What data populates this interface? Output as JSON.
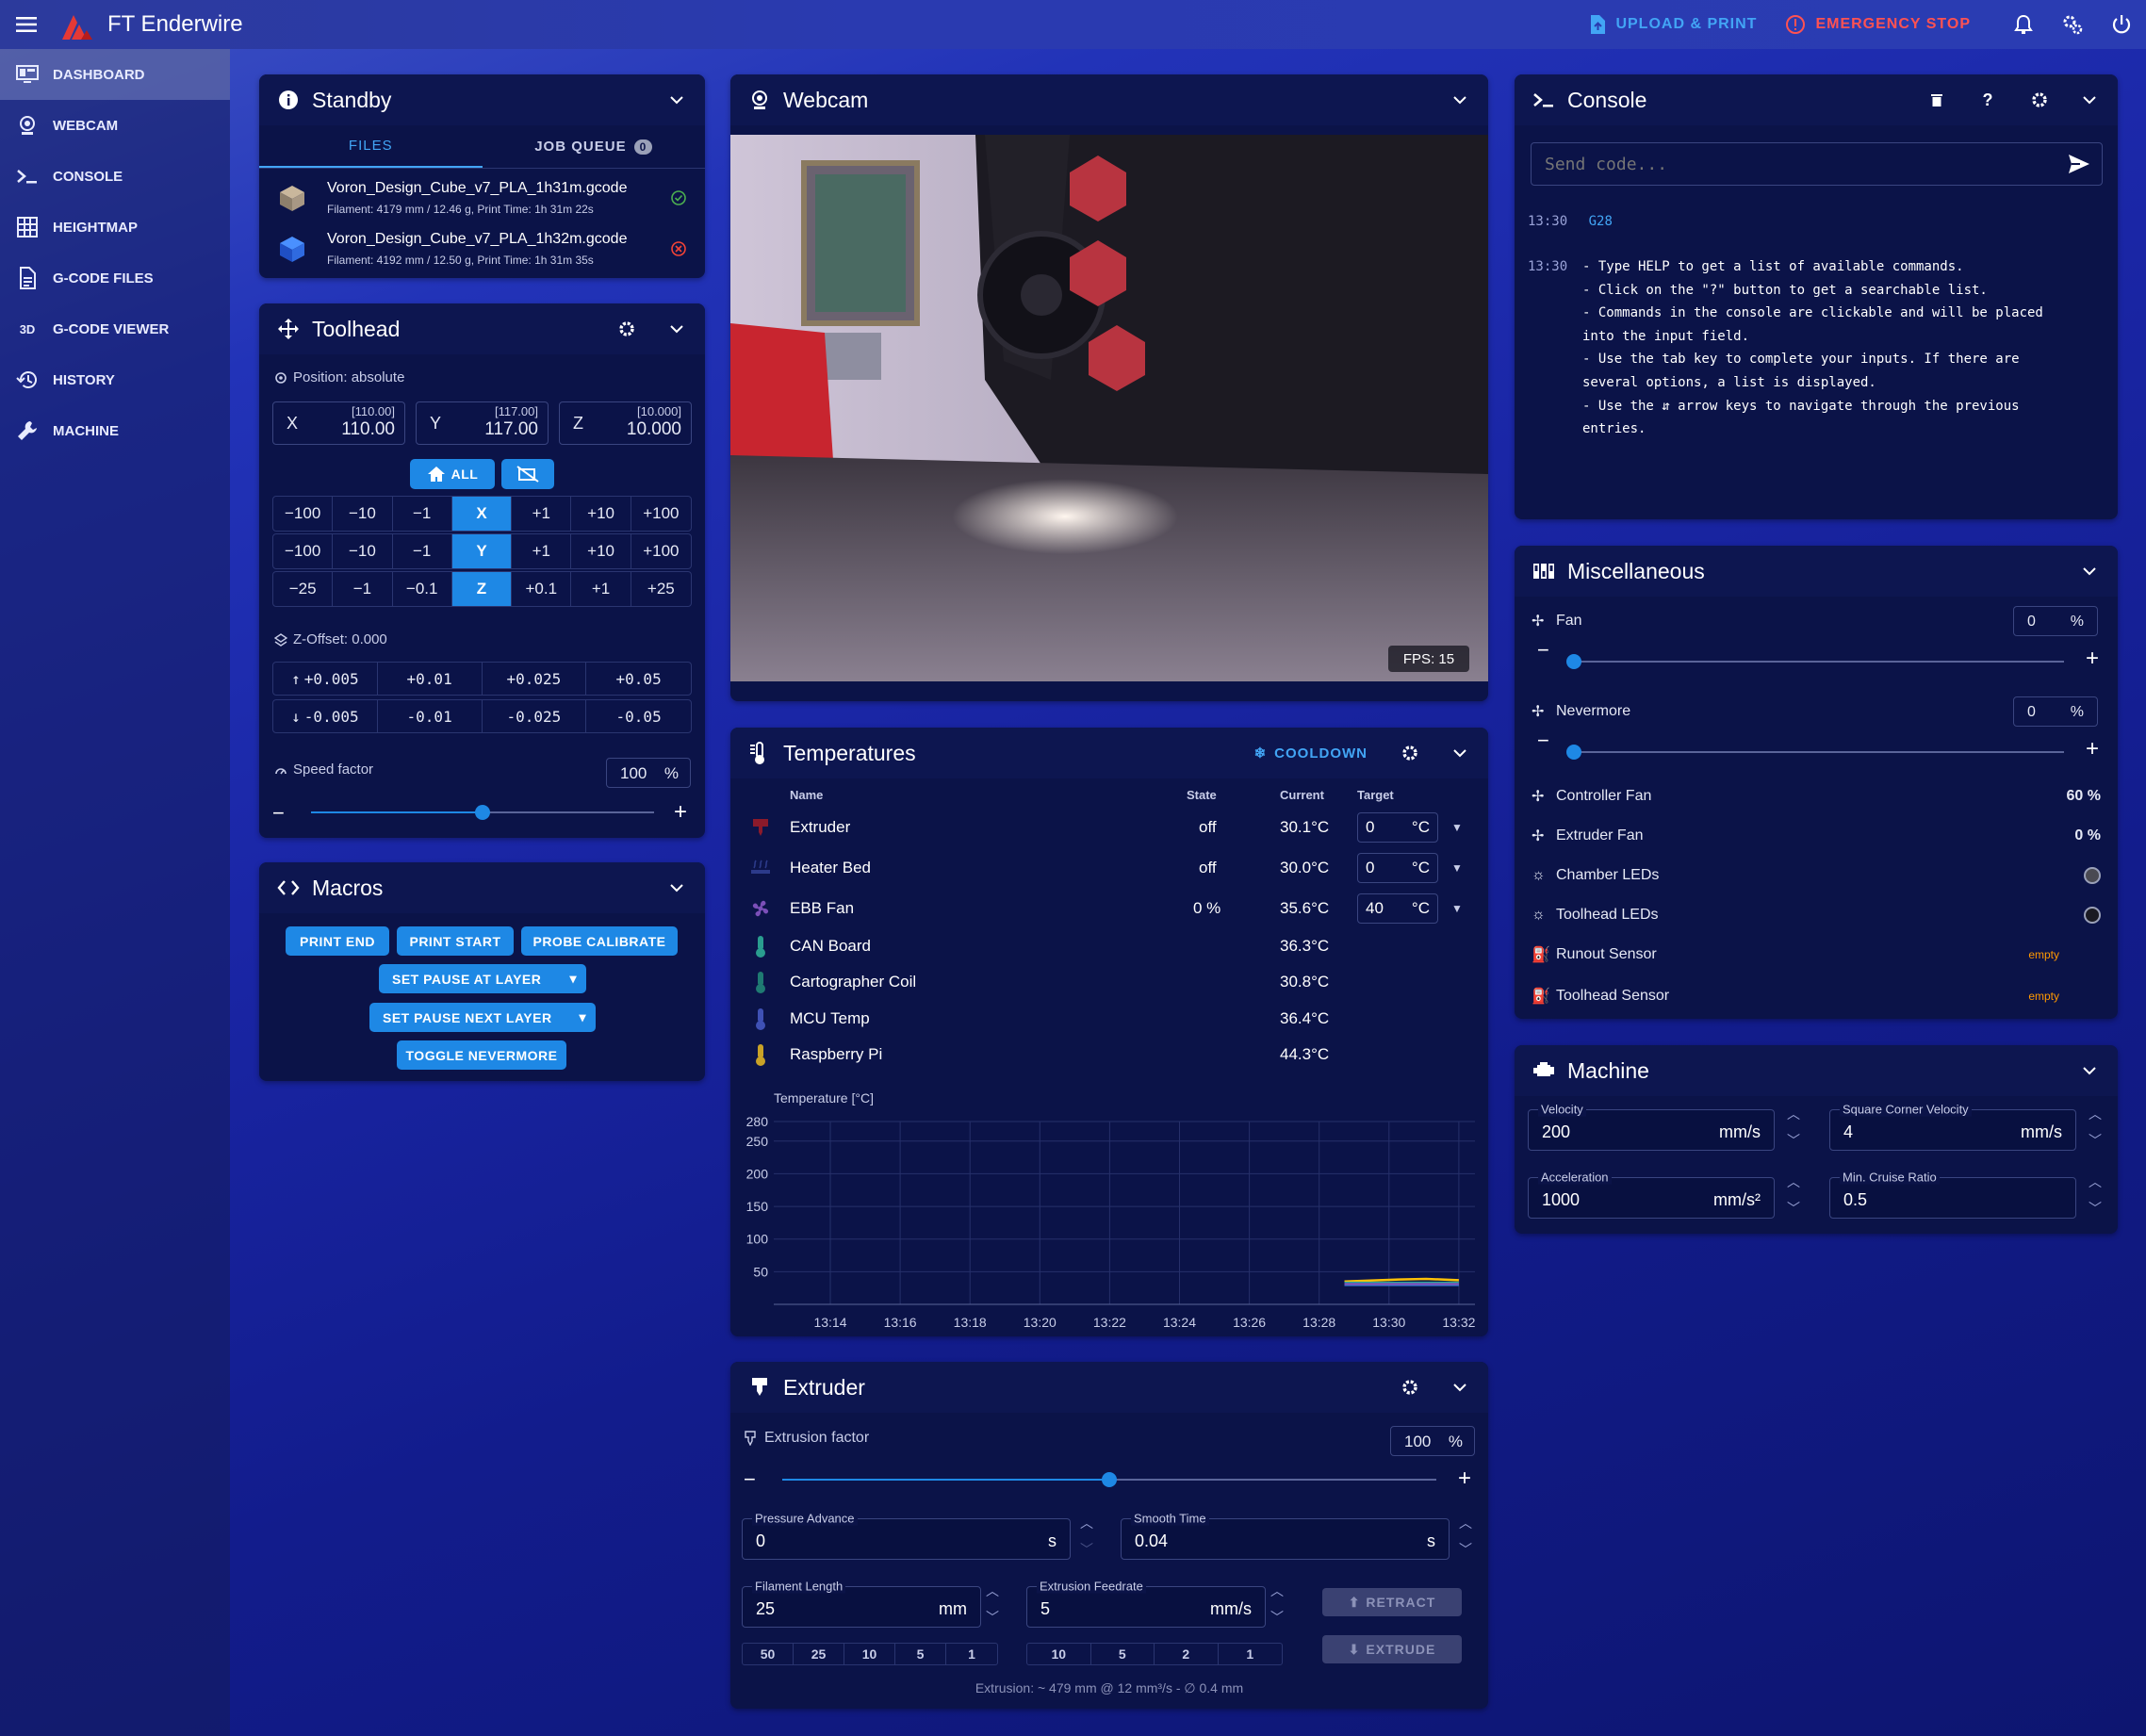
{
  "app": {
    "title": "FT Enderwire",
    "upload_label": "UPLOAD & PRINT",
    "estop_label": "EMERGENCY STOP"
  },
  "colors": {
    "accent": "#1e88e5",
    "estop": "#ff5252",
    "panel": "#0b1348",
    "ok": "#4caf50",
    "err": "#f44336",
    "warn": "#ff9800"
  },
  "sidebar": {
    "items": [
      {
        "label": "DASHBOARD",
        "icon": "monitor-dashboard-icon",
        "active": true
      },
      {
        "label": "WEBCAM",
        "icon": "webcam-icon"
      },
      {
        "label": "CONSOLE",
        "icon": "console-icon"
      },
      {
        "label": "HEIGHTMAP",
        "icon": "grid-icon"
      },
      {
        "label": "G-CODE FILES",
        "icon": "file-document-icon"
      },
      {
        "label": "G-CODE VIEWER",
        "icon": "3d-icon"
      },
      {
        "label": "HISTORY",
        "icon": "history-icon"
      },
      {
        "label": "MACHINE",
        "icon": "wrench-icon"
      }
    ],
    "viewer_glyph": "3D"
  },
  "standby": {
    "title": "Standby",
    "tab_files": "FILES",
    "tab_queue": "JOB QUEUE",
    "queue_count": "0",
    "files": [
      {
        "name": "Voron_Design_Cube_v7_PLA_1h31m.gcode",
        "meta": "Filament: 4179 mm / 12.46 g, Print Time: 1h 31m 22s",
        "status": "ok"
      },
      {
        "name": "Voron_Design_Cube_v7_PLA_1h32m.gcode",
        "meta": "Filament: 4192 mm / 12.50 g, Print Time: 1h 31m 35s",
        "status": "error"
      }
    ]
  },
  "toolhead": {
    "title": "Toolhead",
    "position_label": "Position: absolute",
    "axes": [
      {
        "name": "X",
        "target": "[110.00]",
        "value": "110.00"
      },
      {
        "name": "Y",
        "target": "[117.00]",
        "value": "117.00"
      },
      {
        "name": "Z",
        "target": "[10.000]",
        "value": "10.000"
      }
    ],
    "home_all": "ALL",
    "jog": [
      {
        "axis": "X",
        "steps": [
          "−100",
          "−10",
          "−1",
          "+1",
          "+10",
          "+100"
        ]
      },
      {
        "axis": "Y",
        "steps": [
          "−100",
          "−10",
          "−1",
          "+1",
          "+10",
          "+100"
        ]
      },
      {
        "axis": "Z",
        "steps": [
          "−25",
          "−1",
          "−0.1",
          "+0.1",
          "+1",
          "+25"
        ]
      }
    ],
    "zoffset_label": "Z-Offset: 0.000",
    "zoffset_up": [
      "+0.005",
      "+0.01",
      "+0.025",
      "+0.05"
    ],
    "zoffset_down": [
      "-0.005",
      "-0.01",
      "-0.025",
      "-0.05"
    ],
    "speed_label": "Speed factor",
    "speed_value": "100",
    "speed_unit": "%",
    "speed_pct": 50
  },
  "macros": {
    "title": "Macros",
    "buttons": [
      "PRINT END",
      "PRINT START",
      "PROBE CALIBRATE",
      "SET PAUSE AT LAYER",
      "SET PAUSE NEXT LAYER",
      "TOGGLE NEVERMORE"
    ]
  },
  "webcam": {
    "title": "Webcam",
    "fps": "FPS: 15"
  },
  "temps": {
    "title": "Temperatures",
    "cooldown": "COOLDOWN",
    "headers": {
      "name": "Name",
      "state": "State",
      "current": "Current",
      "target": "Target"
    },
    "rows": [
      {
        "name": "Extruder",
        "state": "off",
        "current": "30.1°C",
        "target": "0",
        "unit": "°C",
        "color": "#8b1a2b",
        "icon": "extruder-icon"
      },
      {
        "name": "Heater Bed",
        "state": "off",
        "current": "30.0°C",
        "target": "0",
        "unit": "°C",
        "color": "#2c3a8a",
        "icon": "bed-icon"
      },
      {
        "name": "EBB Fan",
        "state": "0 %",
        "current": "35.6°C",
        "target": "40",
        "unit": "°C",
        "color": "#7b4fb8",
        "icon": "fan-icon"
      },
      {
        "name": "CAN Board",
        "current": "36.3°C",
        "color": "#2a9d8f",
        "icon": "thermometer-icon"
      },
      {
        "name": "Cartographer Coil",
        "current": "30.8°C",
        "color": "#1f7a72",
        "icon": "thermometer-icon"
      },
      {
        "name": "MCU Temp",
        "current": "36.4°C",
        "color": "#3f51b5",
        "icon": "thermometer-icon"
      },
      {
        "name": "Raspberry Pi",
        "current": "44.3°C",
        "color": "#c9a227",
        "icon": "thermometer-icon"
      }
    ]
  },
  "chart_data": {
    "type": "line",
    "ylabel": "Temperature [°C]",
    "ylim": [
      0,
      280
    ],
    "yticks": [
      "280",
      "250",
      "200",
      "150",
      "100",
      "50"
    ],
    "x": [
      "13:14",
      "13:16",
      "13:18",
      "13:20",
      "13:22",
      "13:24",
      "13:26",
      "13:28",
      "13:30",
      "13:32"
    ],
    "series": [
      {
        "color": "#ffc107",
        "points": [
          [
            13.5,
            35
          ],
          [
            14.5,
            38
          ],
          [
            15,
            39
          ],
          [
            15.6,
            37
          ]
        ]
      },
      {
        "color": "#2196f3",
        "points": [
          [
            13.5,
            30
          ],
          [
            15.6,
            30
          ]
        ]
      },
      {
        "color": "#26a69a",
        "points": [
          [
            13.5,
            33
          ],
          [
            15.6,
            33
          ]
        ]
      },
      {
        "color": "#7b4fb8",
        "points": [
          [
            13.5,
            31
          ],
          [
            15.6,
            31
          ]
        ]
      }
    ]
  },
  "extruder": {
    "title": "Extruder",
    "factor_label": "Extrusion factor",
    "factor_value": "100",
    "factor_unit": "%",
    "factor_pct": 50,
    "pa_label": "Pressure Advance",
    "pa_value": "0",
    "pa_unit": "s",
    "st_label": "Smooth Time",
    "st_value": "0.04",
    "st_unit": "s",
    "len_label": "Filament Length",
    "len_value": "25",
    "len_unit": "mm",
    "feed_label": "Extrusion Feedrate",
    "feed_value": "5",
    "feed_unit": "mm/s",
    "len_presets": [
      "50",
      "25",
      "10",
      "5",
      "1"
    ],
    "feed_presets": [
      "10",
      "5",
      "2",
      "1"
    ],
    "retract": "RETRACT",
    "extrude": "EXTRUDE",
    "info": "Extrusion: ~ 479 mm @ 12 mm³/s - ∅ 0.4 mm"
  },
  "console": {
    "title": "Console",
    "placeholder": "Send code...",
    "lines": [
      {
        "time": "13:30",
        "cmd": "G28"
      },
      {
        "time": "13:30",
        "text": "- Type HELP to get a list of available commands.\n- Click on the \"?\" button to get a searchable list.\n- Commands in the console are clickable and will be placed\ninto the input field.\n- Use the tab key to complete your inputs. If there are\nseveral options, a list is displayed.\n- Use the ⇵ arrow keys to navigate through the previous\nentries."
      }
    ]
  },
  "misc": {
    "title": "Miscellaneous",
    "fans": [
      {
        "name": "Fan",
        "value": "0",
        "unit": "%"
      },
      {
        "name": "Nevermore",
        "value": "0",
        "unit": "%"
      }
    ],
    "controller_fan": {
      "name": "Controller Fan",
      "value": "60 %"
    },
    "extruder_fan": {
      "name": "Extruder Fan",
      "value": "0 %"
    },
    "leds": [
      "Chamber LEDs",
      "Toolhead LEDs"
    ],
    "sensors": [
      {
        "name": "Runout Sensor",
        "state": "empty"
      },
      {
        "name": "Toolhead Sensor",
        "state": "empty"
      }
    ]
  },
  "machine": {
    "title": "Machine",
    "fields": [
      {
        "label": "Velocity",
        "value": "200",
        "unit": "mm/s"
      },
      {
        "label": "Square Corner Velocity",
        "value": "4",
        "unit": "mm/s"
      },
      {
        "label": "Acceleration",
        "value": "1000",
        "unit": "mm/s²"
      },
      {
        "label": "Min. Cruise Ratio",
        "value": "0.5",
        "unit": ""
      }
    ]
  }
}
